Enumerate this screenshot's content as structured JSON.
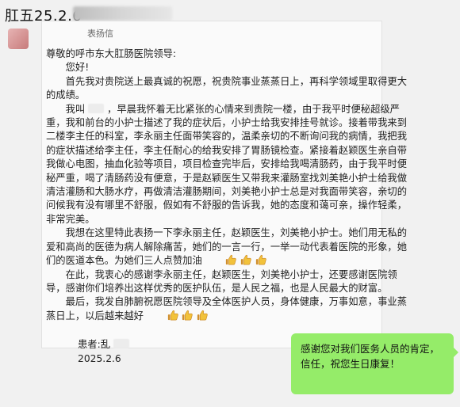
{
  "header": {
    "title": "肛五25.2.6"
  },
  "letter": {
    "cut_text": "表扬信",
    "salutation": "尊敬的呼市东大肛肠医院领导:",
    "greeting": "您好!",
    "paragraphs": [
      "首先我对贵院送上最真诚的祝愿，祝贵院事业蒸蒸日上，再科学领域里取得更大的成绩。",
      "我叫",
      "，早晨我怀着无比紧张的心情来到贵院一楼，由于我平时便秘超级严重，我和前台的小护士描述了我的症状后，小护士给我安排挂号就诊。接着带我来到二楼李主任的科室，李永丽主任面带笑容的，温柔亲切的不断询问我的病情，我把我的症状描述给李主任，李主任耐心的给我安排了胃肠镜检查。紧接着赵颖医生亲自带我做心电图，抽血化验等项目，项目检查完毕后，安排给我喝清肠药，由于我平时便秘严重，喝了清肠药没有便意，于是赵颖医生又带我来灌肠室找刘美艳小护士给我做清洁灌肠和大肠水疗，再做清洁灌肠期间，刘美艳小护士总是对我面带笑容，亲切的问候我有没有哪里不舒服，假如有不舒服的告诉我，她的态度和蔼可亲，操作轻柔，非常完美。",
      "我想在这里特此表扬一下李永丽主任，赵颖医生，刘美艳小护士。她们用无私的爱和高尚的医德为病人解除痛苦，她们的一言一行，一举一动代表着医院的形象，她们的医道本色。为她们三人点赞加油",
      "在此，我衷心的感谢李永丽主任，赵颖医生，刘美艳小护士，还要感谢医院领导，感谢你们培养出这样优秀的医护队伍，是人民之福，也是人民最大的财富。",
      "最后，我发自肺腑祝愿医院领导及全体医护人员，身体健康，万事如意，事业蒸蒸日上，以后越来越好"
    ],
    "signature_name": "患者:乱",
    "signature_date": "2025.2.6"
  },
  "reply": {
    "text": "感谢您对我们医务人员的肯定，信任，祝您生日康复！"
  },
  "icons": {
    "emoji": "thumbs-up-icon"
  },
  "colors": {
    "bubble": "#95ec69",
    "background": "#f1f1f1"
  }
}
